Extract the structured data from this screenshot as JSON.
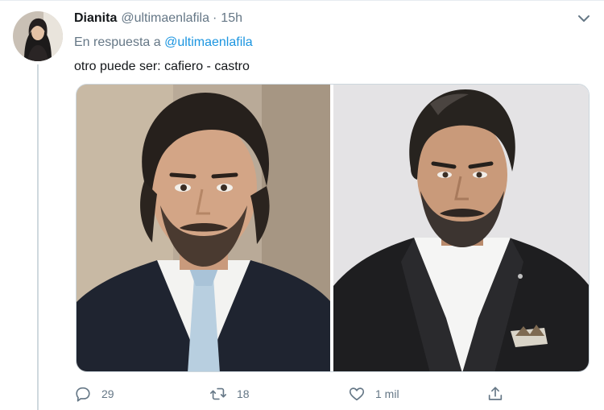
{
  "tweet": {
    "author_name": "Dianita",
    "handle": "@ultimaenlafila",
    "separator": "·",
    "time": "15h",
    "reply_prefix": "En respuesta a",
    "reply_mention": "@ultimaenlafila",
    "text": "otro puede ser: cafiero - castro"
  },
  "actions": {
    "replies": "29",
    "retweets": "18",
    "likes": "1 mil"
  },
  "icons": {
    "reply": "reply-icon",
    "retweet": "retweet-icon",
    "like": "heart-icon",
    "share": "share-icon",
    "more": "chevron-down-icon"
  },
  "colors": {
    "link": "#1b95e0",
    "muted": "#657786",
    "text": "#14171a"
  }
}
